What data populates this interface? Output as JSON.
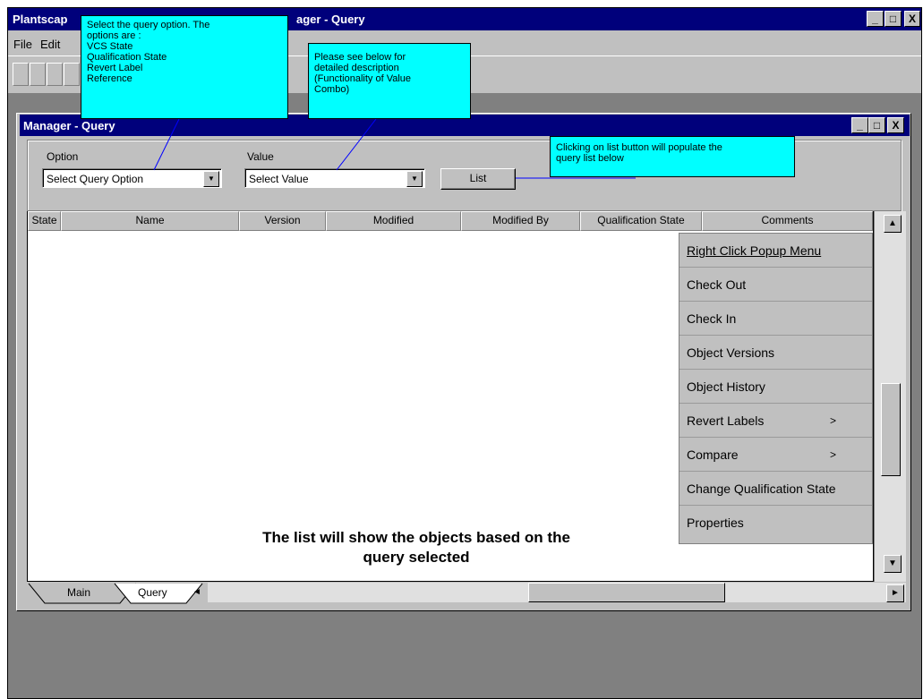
{
  "app_window": {
    "title_left": "Plantscap",
    "title_right": "ager - Query",
    "controls": [
      "_",
      "□",
      "X"
    ]
  },
  "menubar": {
    "items": [
      "File",
      "Edit"
    ]
  },
  "inner_window": {
    "title": "Manager - Query",
    "controls": [
      "_",
      "□",
      "X"
    ]
  },
  "query": {
    "option_label": "Option",
    "option_value": "Select Query Option",
    "value_label": "Value",
    "value_value": "Select Value",
    "list_button": "List"
  },
  "table": {
    "columns": [
      "State",
      "Name",
      "Version",
      "Modified",
      "Modified By",
      "Qualification State",
      "Comments"
    ]
  },
  "context_menu": {
    "title": "Right Click Popup Menu",
    "items": [
      {
        "label": "Check Out",
        "arrow": ""
      },
      {
        "label": "Check In",
        "arrow": ""
      },
      {
        "label": "Object Versions",
        "arrow": ""
      },
      {
        "label": "Object History",
        "arrow": ""
      },
      {
        "label": "Revert Labels",
        "arrow": ">"
      },
      {
        "label": "Compare",
        "arrow": ">"
      },
      {
        "label": "Change Qualification State",
        "arrow": ""
      },
      {
        "label": "Properties",
        "arrow": ""
      }
    ]
  },
  "tabs": [
    "Main",
    "Query"
  ],
  "callouts": {
    "option_note": [
      "Select the query option. The",
      "options are :",
      "VCS State",
      "Qualification State",
      "Revert Label",
      "Reference"
    ],
    "value_note": [
      "Please see below for",
      "detailed description",
      "(Functionality of Value",
      "Combo)"
    ],
    "list_note": [
      "Clicking on list button will populate the",
      "query list below"
    ]
  },
  "list_note": [
    "The list will show the objects based on the",
    "query selected"
  ],
  "scroll_glyphs": {
    "up": "▲",
    "down": "▼",
    "left": "◄",
    "right": "►",
    "drop": "▼"
  },
  "colors": {
    "title_bar": "#00007b",
    "callout": "#00ffff",
    "face": "#c0c0c0",
    "workspace": "#808080"
  }
}
